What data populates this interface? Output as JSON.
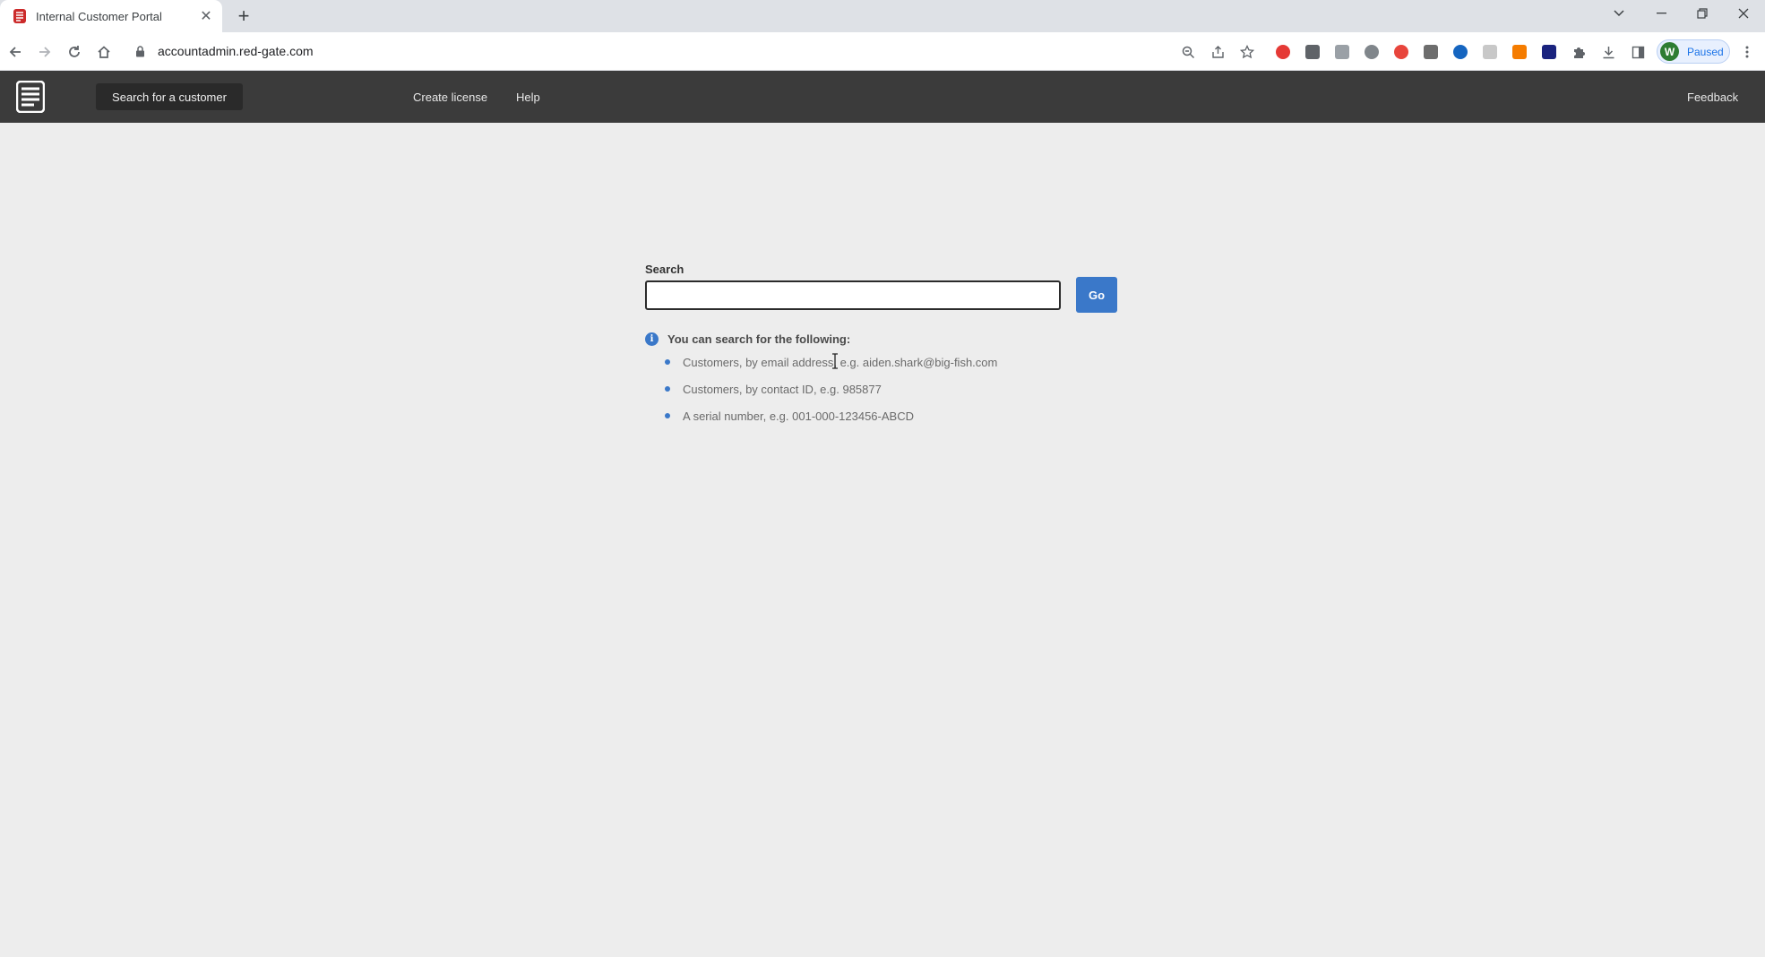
{
  "browser": {
    "tab_title": "Internal Customer Portal",
    "url": "accountadmin.red-gate.com",
    "profile_initial": "W",
    "profile_status": "Paused"
  },
  "navbar": {
    "search_customer": "Search for a customer",
    "create_license": "Create license",
    "help": "Help",
    "feedback": "Feedback"
  },
  "search": {
    "label": "Search",
    "value": "",
    "go_label": "Go",
    "hint_title": "You can search for the following:",
    "hints": [
      "Customers, by email address, e.g. aiden.shark@big-fish.com",
      "Customers, by contact ID, e.g. 985877",
      "A serial number, e.g. 001-000-123456-ABCD"
    ]
  },
  "colors": {
    "navbar_bg": "#3b3b3b",
    "accent": "#3a78c9",
    "page_bg": "#ededed"
  }
}
